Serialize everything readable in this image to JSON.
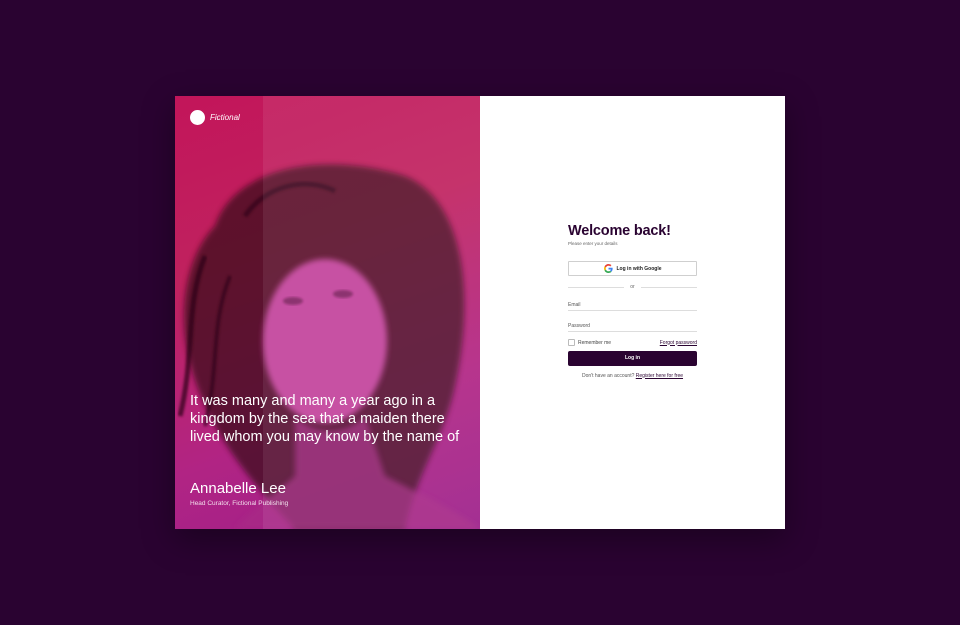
{
  "hero": {
    "brand_name": "Fictional",
    "quote": "It was many and many a year ago in a kingdom by the sea that a maiden there lived whom you may know by the name of",
    "author": "Annabelle Lee",
    "role": "Head Curator, Fictional Publishing"
  },
  "form": {
    "title": "Welcome back!",
    "subtitle": "Please enter your details",
    "google_button": "Log in with Google",
    "or_divider": "or",
    "email_placeholder": "Email",
    "password_placeholder": "Password",
    "remember_me": "Remember me",
    "forgot_password": "Forgot password",
    "login_button": "Log in",
    "register_prompt": "Don't have an account?",
    "register_link": "Register here for free"
  },
  "colors": {
    "background": "#2a0331",
    "primary": "#2a0331",
    "hero_gradient_start": "#c2155a",
    "hero_gradient_end": "#9c1f8a"
  },
  "icons": {
    "brand": "logo-circle",
    "google": "google-g-icon"
  }
}
